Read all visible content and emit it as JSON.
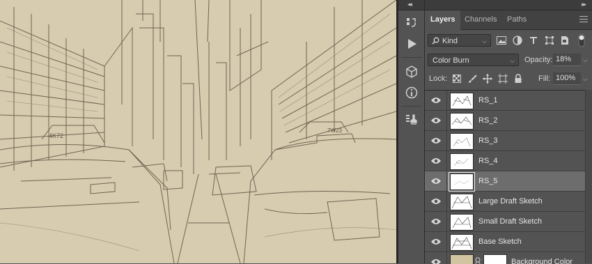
{
  "panel": {
    "tabs": [
      {
        "label": "Layers",
        "active": true
      },
      {
        "label": "Channels",
        "active": false
      },
      {
        "label": "Paths",
        "active": false
      }
    ],
    "filter": {
      "kind_label": "Kind"
    },
    "blend": {
      "mode": "Color Burn",
      "opacity_label": "Opacity:",
      "opacity_value": "18%"
    },
    "lock": {
      "label": "Lock:",
      "fill_label": "Fill:",
      "fill_value": "100%"
    },
    "layers": [
      {
        "name": "RS_1",
        "selected": false
      },
      {
        "name": "RS_2",
        "selected": false
      },
      {
        "name": "RS_3",
        "selected": false
      },
      {
        "name": "RS_4",
        "selected": false
      },
      {
        "name": "RS_5",
        "selected": true
      },
      {
        "name": "Large Draft Sketch",
        "selected": false
      },
      {
        "name": "Small Draft Sketch",
        "selected": false
      },
      {
        "name": "Base Sketch",
        "selected": false
      },
      {
        "name": "Background Color",
        "selected": false,
        "has_mask": true
      }
    ]
  },
  "colors": {
    "canvas_paper": "#d7ccb0",
    "panel_bg": "#535353",
    "selected_layer": "#6d6d6d",
    "background_swatch": "#d0c4a1"
  },
  "icons": {
    "iconbar": [
      "history-icon",
      "play-action-icon",
      "3d-cube-icon",
      "info-icon",
      "clone-source-icon"
    ],
    "filters": [
      "image-filter-icon",
      "adjustment-filter-icon",
      "type-filter-icon",
      "shape-filter-icon",
      "smart-object-filter-icon",
      "filter-toggle-icon"
    ],
    "locks": [
      "lock-transparent-pixels-icon",
      "lock-image-pixels-icon",
      "lock-position-icon",
      "lock-artboard-icon",
      "lock-all-icon"
    ]
  }
}
